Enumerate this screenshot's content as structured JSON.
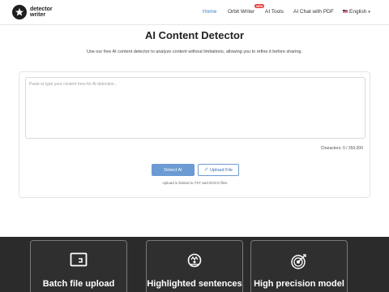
{
  "header": {
    "logo": {
      "line1": "detector",
      "line2": "writer"
    },
    "nav": {
      "home": "Home",
      "orbit_writer": "Orbit Writer",
      "orbit_badge": "NEW",
      "ai_tools": "AI Tools",
      "ai_chat_pdf": "AI Chat with PDF",
      "language": "English"
    }
  },
  "main": {
    "title": "AI Content Detector",
    "subtitle": "Use our free AI content detector to analyze content without limitations, allowing you to refine it before sharing.",
    "input_placeholder": "Paste or type your content here for AI detection...",
    "characters_label": "Characters: 0 / 350,000",
    "detect_button": "Detect AI",
    "upload_button": "Upload File",
    "upload_note": "Upload is limited to TXT and DOCX files."
  },
  "features": [
    {
      "label": "Batch file upload",
      "icon": "folder-icon"
    },
    {
      "label": "Highlighted sentences",
      "icon": "highlight-icon"
    },
    {
      "label": "High precision model",
      "icon": "target-icon"
    }
  ],
  "colors": {
    "accent": "#3b82c4",
    "detect_button": "#6b9bd2",
    "band": "#2b2b2b",
    "badge": "#e53935"
  }
}
